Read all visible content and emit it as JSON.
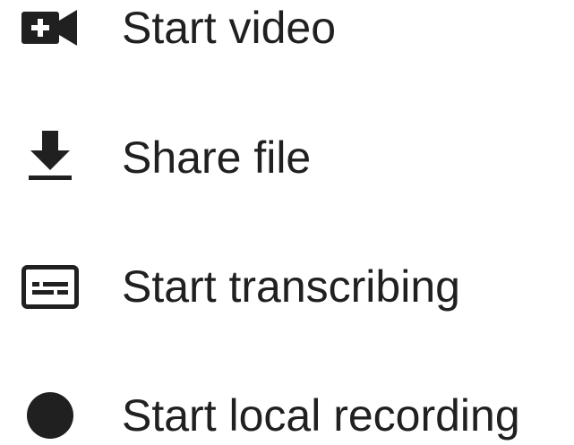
{
  "menu": {
    "items": [
      {
        "label": "Start video",
        "icon": "video-plus-icon"
      },
      {
        "label": "Share file",
        "icon": "download-icon"
      },
      {
        "label": "Start transcribing",
        "icon": "subtitles-icon"
      },
      {
        "label": "Start local recording",
        "icon": "record-circle-icon"
      }
    ]
  },
  "colors": {
    "icon": "#202020",
    "text": "#202020",
    "background": "#ffffff"
  }
}
